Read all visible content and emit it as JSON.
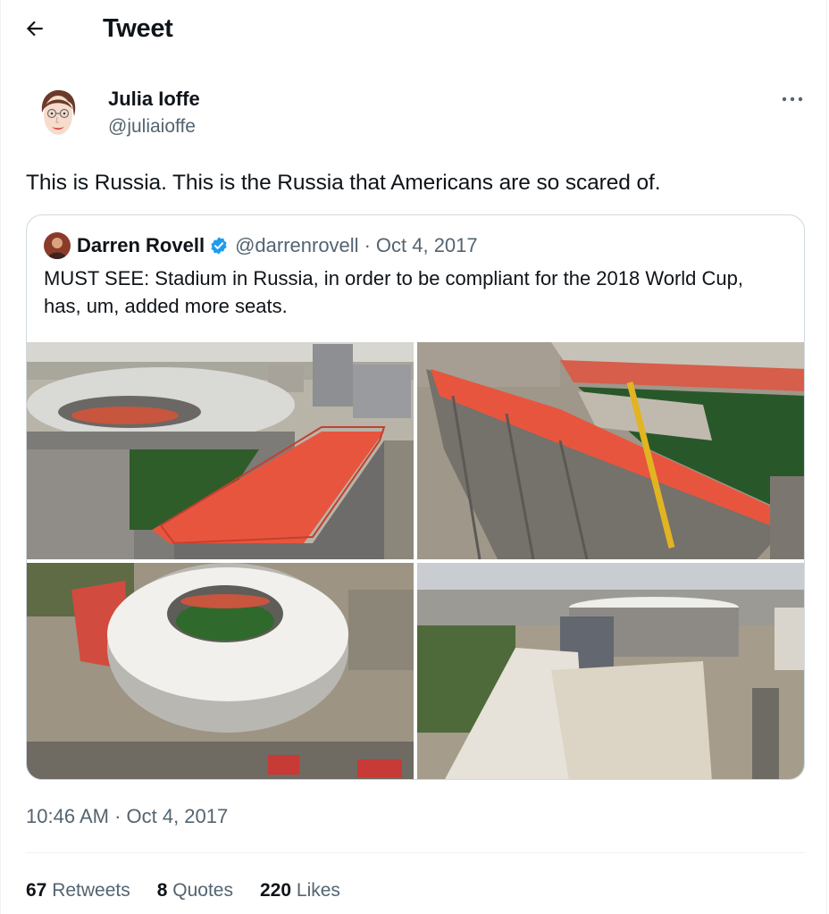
{
  "header": {
    "title": "Tweet",
    "back_icon": "arrow-left-icon"
  },
  "tweet": {
    "author_name": "Julia Ioffe",
    "author_handle": "@juliaioffe",
    "text": "This is Russia. This is the Russia that Americans are so scared of.",
    "more_icon": "more-horizontal-icon"
  },
  "quote": {
    "author_name": "Darren Rovell",
    "verified_icon": "verified-badge-icon",
    "author_handle": "@darrenrovell",
    "separator": "·",
    "date": "Oct 4, 2017",
    "text": "MUST SEE: Stadium in Russia, in order to be compliant for the 2018 World Cup, has, um, added more seats."
  },
  "timestamp": "10:46 AM · Oct 4, 2017",
  "stats": {
    "retweets_count": "67",
    "retweets_label": "Retweets",
    "quotes_count": "8",
    "quotes_label": "Quotes",
    "likes_count": "220",
    "likes_label": "Likes"
  },
  "colors": {
    "text": "#0f1419",
    "secondary": "#536471",
    "border": "#cfd9de",
    "verified": "#1d9bf0",
    "stadium_seats": "#e8553e",
    "pitch": "#2f5d2a"
  }
}
